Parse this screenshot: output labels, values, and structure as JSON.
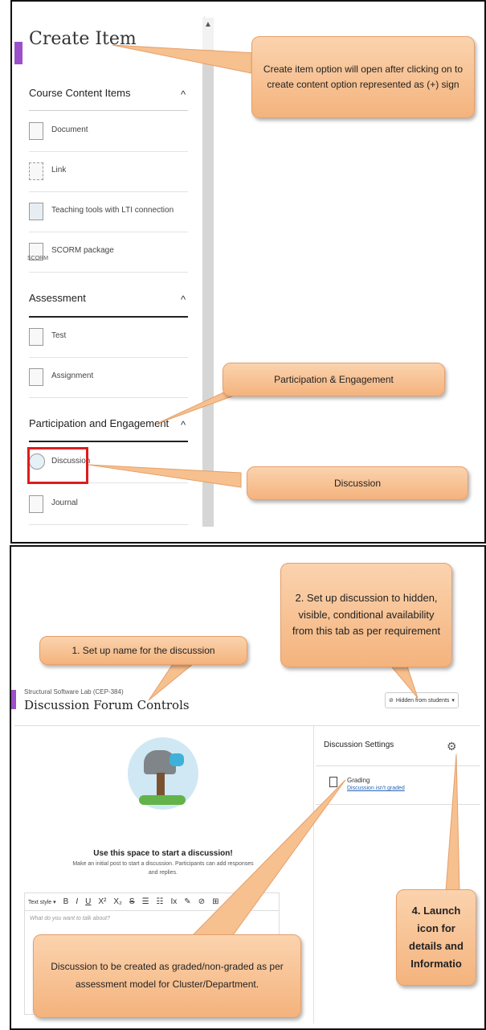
{
  "panel1": {
    "title": "Create Item",
    "scroll_up": "▲",
    "sections": [
      {
        "label": "Course Content Items",
        "chevron": "^",
        "items": [
          {
            "label": "Document",
            "icon": "document-icon"
          },
          {
            "label": "Link",
            "icon": "link-icon"
          },
          {
            "label": "Teaching tools with LTI connection",
            "icon": "lti-tool-icon"
          },
          {
            "label": "SCORM package",
            "icon": "scorm-icon",
            "icon_text": "SCORM"
          }
        ]
      },
      {
        "label": "Assessment",
        "chevron": "^",
        "items": [
          {
            "label": "Test",
            "icon": "test-icon"
          },
          {
            "label": "Assignment",
            "icon": "assignment-icon"
          }
        ]
      },
      {
        "label": "Participation and Engagement",
        "chevron": "^",
        "items": [
          {
            "label": "Discussion",
            "icon": "discussion-icon"
          },
          {
            "label": "Journal",
            "icon": "journal-icon"
          }
        ]
      }
    ],
    "callouts": {
      "create_item": "Create item option will open after clicking on to create content option represented as (+) sign",
      "participation": "Participation & Engagement",
      "discussion": "Discussion"
    }
  },
  "panel2": {
    "course": "Structural Software Lab (CEP-384)",
    "title": "Discussion Forum Controls",
    "visibility": "Hidden from students",
    "visibility_caret": "▾",
    "empty_title": "Use this space to start a discussion!",
    "empty_desc": "Make an initial post to start a discussion. Participants can add responses and replies.",
    "toolbar": {
      "text_style": "Text style",
      "caret": "▾",
      "buttons": [
        "B",
        "I",
        "U",
        "X²",
        "X₂",
        "S",
        "☰",
        "☷",
        "Ix",
        "✎",
        "⊘",
        "⊞"
      ]
    },
    "editor_placeholder": "What do you want to talk about?",
    "settings_title": "Discussion Settings",
    "grading_label": "Grading",
    "grading_value": "Discussion isn't graded",
    "callouts": {
      "step1": "1. Set up name for the discussion",
      "step2": "2.  Set up discussion to hidden, visible, conditional availability from this tab as per requirement",
      "step4": "4. Launch icon for details and Informatio",
      "graded": "Discussion to be created as graded/non-graded as per assessment model for Cluster/Department."
    }
  },
  "colors": {
    "accent": "#9b4fc9",
    "callout": "#f4b37d",
    "highlight": "#e01b1b"
  }
}
